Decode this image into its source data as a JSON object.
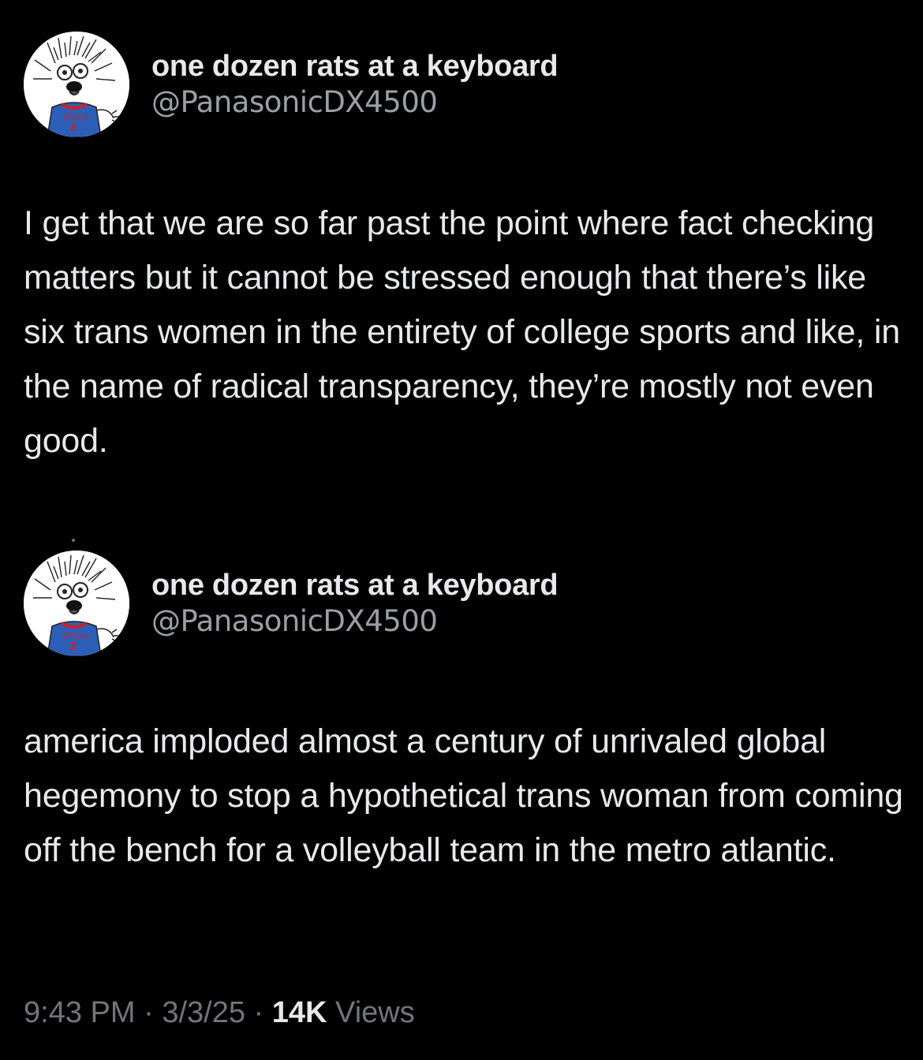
{
  "tweets": [
    {
      "display_name": "one dozen rats at a keyboard",
      "handle": "@PanasonicDX4500",
      "avatar_icon": "cartoon-creature-avatar-icon",
      "avatar_jersey_text": "PHILA",
      "avatar_jersey_number": "3",
      "text": "I get that we are so far past the point where fact checking matters but it cannot be stressed enough that there’s like six trans women in the entirety of college sports and like, in the name of radical transparency, they’re mostly not even good."
    },
    {
      "display_name": "one dozen rats at a keyboard",
      "handle": "@PanasonicDX4500",
      "avatar_icon": "cartoon-creature-avatar-icon",
      "avatar_jersey_text": "PHILA",
      "avatar_jersey_number": "3",
      "text": "america imploded almost a century of unrivaled global hegemony to stop a hypothetical trans woman from coming off the bench for a volleyball team in the metro atlantic."
    }
  ],
  "meta": {
    "time": "9:43 PM",
    "separator": "·",
    "date": "3/3/25",
    "views_count": "14K",
    "views_label": "Views"
  },
  "colors": {
    "background": "#000000",
    "text": "#e7e9ea",
    "secondary": "#71767b",
    "jersey": "#2d5fb8",
    "jersey_trim": "#c8242b"
  }
}
